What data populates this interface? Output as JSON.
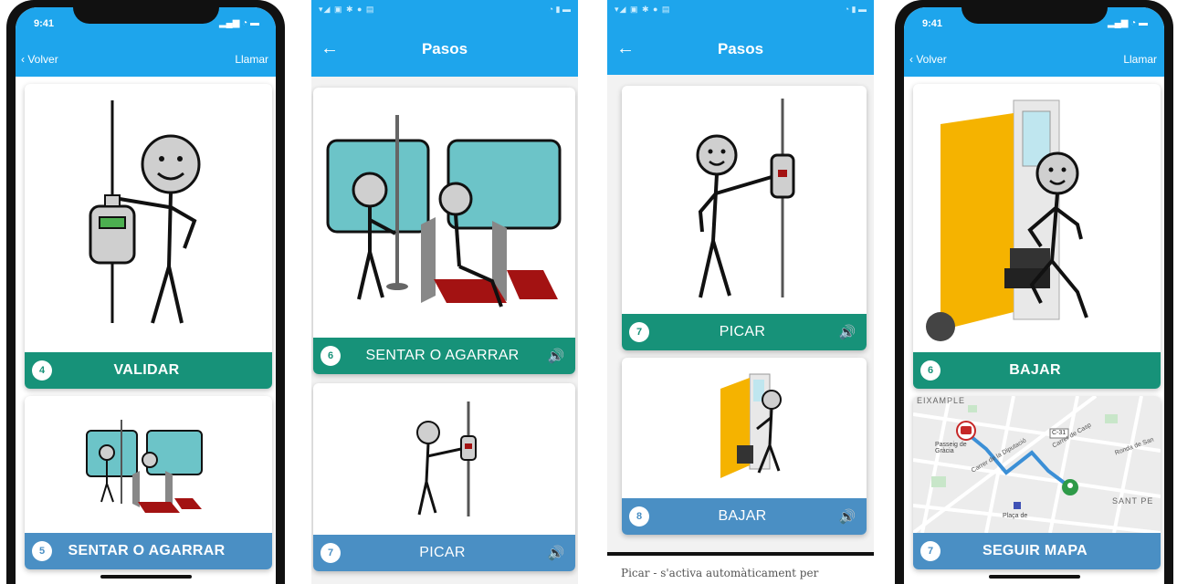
{
  "colors": {
    "header": "#1ea5ec",
    "green_bar": "#179279",
    "blue_bar": "#4a8fc4",
    "bus_seat": "#6cc4c8",
    "door": "#f5b300"
  },
  "phone1": {
    "time": "9:41",
    "back_label": "Volver",
    "call_label": "Llamar",
    "cards": [
      {
        "number": "4",
        "label": "VALIDAR"
      },
      {
        "number": "5",
        "label": "SENTAR O AGARRAR"
      }
    ]
  },
  "phone2": {
    "title": "Pasos",
    "cards": [
      {
        "number": "6",
        "label": "SENTAR O AGARRAR",
        "speaker": "speaker-icon"
      },
      {
        "number": "7",
        "label": "PICAR",
        "speaker": "speaker-icon"
      }
    ]
  },
  "phone3": {
    "title": "Pasos",
    "cards": [
      {
        "number": "7",
        "label": "PICAR",
        "speaker": "speaker-icon"
      },
      {
        "number": "8",
        "label": "BAJAR",
        "speaker": "speaker-icon"
      }
    ],
    "caption": "Picar - s'activa automàticament per"
  },
  "phone4": {
    "time": "9:41",
    "back_label": "Volver",
    "call_label": "Llamar",
    "cards": [
      {
        "number": "6",
        "label": "BAJAR"
      },
      {
        "number": "7",
        "label": "SEGUIR MAPA"
      }
    ],
    "map": {
      "district": "EIXAMPLE",
      "area_label": "SANT PE",
      "stop_label": "Passeig de Gràcia",
      "road_label": "C-31",
      "streets": [
        "Carrer de la Diputació",
        "Carrer de Casp",
        "Ronda de San"
      ],
      "square": "Plaça de"
    }
  }
}
